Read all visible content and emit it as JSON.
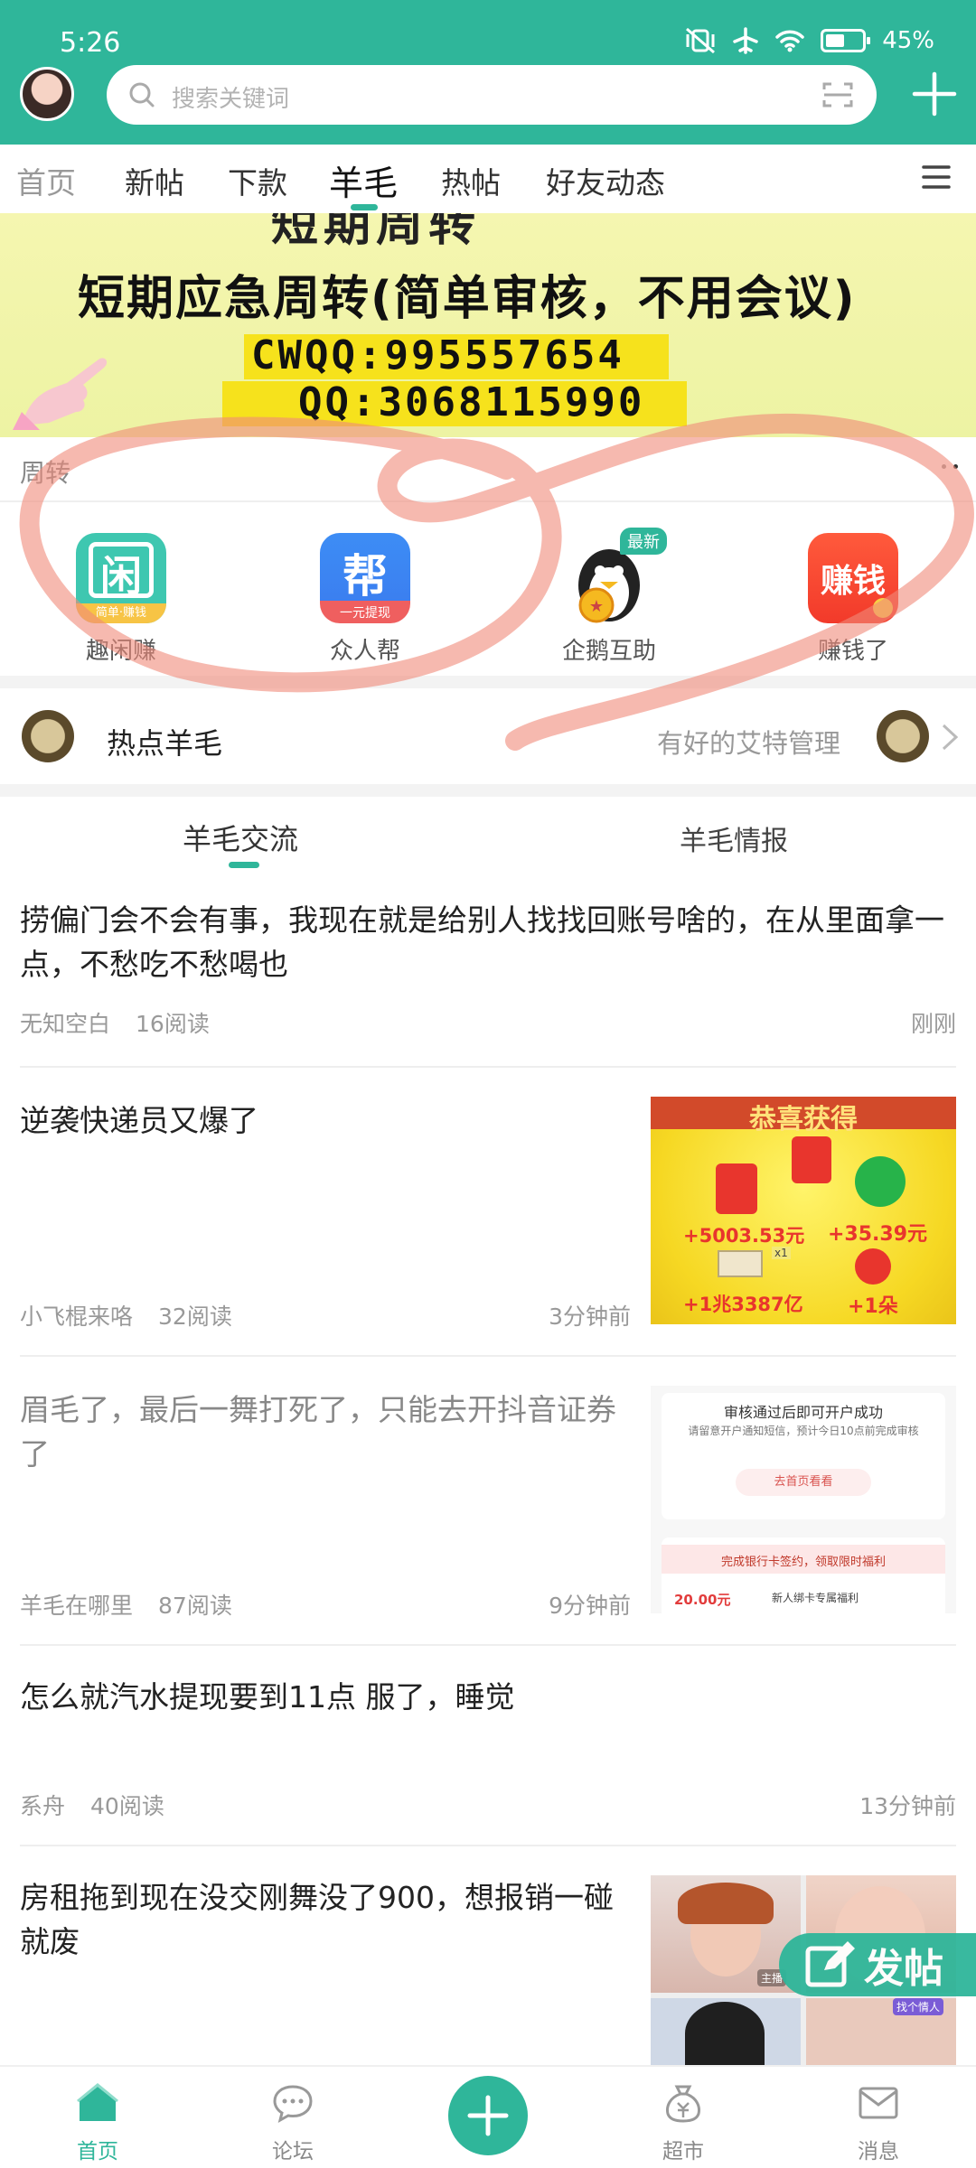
{
  "status": {
    "time": "5:26",
    "battery": "45%"
  },
  "search": {
    "placeholder": "搜索关键词"
  },
  "tabs": [
    {
      "label": "首页"
    },
    {
      "label": "新帖"
    },
    {
      "label": "下款"
    },
    {
      "label": "羊毛"
    },
    {
      "label": "热帖"
    },
    {
      "label": "好友动态"
    }
  ],
  "banner": {
    "top_cut_text": "短期周转",
    "line1": "短期应急周转(简单审核，不用会议)",
    "line2": "CWQQ:995557654",
    "line3": "QQ:3068115990",
    "caption": "周转"
  },
  "apps": [
    {
      "label": "趣闲赚",
      "icon_text": "闲",
      "sub_text": "简单·赚钱"
    },
    {
      "label": "众人帮",
      "icon_text": "帮",
      "sub_text": "一元提现"
    },
    {
      "label": "企鹅互助",
      "badge": "最新"
    },
    {
      "label": "赚钱了",
      "icon_text": "赚钱"
    }
  ],
  "hot": {
    "title": "热点羊毛",
    "admin_text": "有好的艾特管理"
  },
  "subtabs": [
    {
      "label": "羊毛交流"
    },
    {
      "label": "羊毛情报"
    }
  ],
  "posts": [
    {
      "title": "捞偏门会不会有事，我现在就是给别人找找回账号啥的，在从里面拿一点，不愁吃不愁喝也",
      "author": "无知空白",
      "reads": "16阅读",
      "time": "刚刚"
    },
    {
      "title": "逆袭快递员又爆了",
      "author": "小飞棍来咯",
      "reads": "32阅读",
      "time": "3分钟前",
      "thumb": {
        "header": "恭喜获得",
        "v1": "+5003.53元",
        "v2": "+35.39元",
        "v3": "+1兆3387亿",
        "v4": "+1朵",
        "mult": "x1"
      }
    },
    {
      "title": "眉毛了，最后一舞打死了，只能去开抖音证券了",
      "author": "羊毛在哪里",
      "reads": "87阅读",
      "time": "9分钟前",
      "thumb": {
        "t1": "审核通过后即可开户成功",
        "t2": "请留意开户通知短信，预计今日10点前完成审核",
        "btn": "去首页看看",
        "t3": "完成银行卡签约，领取限时福利",
        "amount": "20.00元",
        "t4": "新人绑卡专属福利"
      }
    },
    {
      "title": "怎么就汽水提现要到11点 服了，睡觉",
      "author": "系舟",
      "reads": "40阅读",
      "time": "13分钟前"
    },
    {
      "title": "房租拖到现在没交刚舞没了900，想报销一碰就废",
      "thumb": {
        "tag1": "主播",
        "tag2": "找个情人"
      }
    }
  ],
  "fab": {
    "label": "发帖"
  },
  "bottom_nav": [
    {
      "label": "首页"
    },
    {
      "label": "论坛"
    },
    {
      "label": "超市"
    },
    {
      "label": "消息"
    }
  ],
  "colors": {
    "accent": "#2fb69a",
    "banner_bg": "#f0f4a8",
    "highlight": "#f6e21c",
    "scribble": "#f08a7a"
  }
}
